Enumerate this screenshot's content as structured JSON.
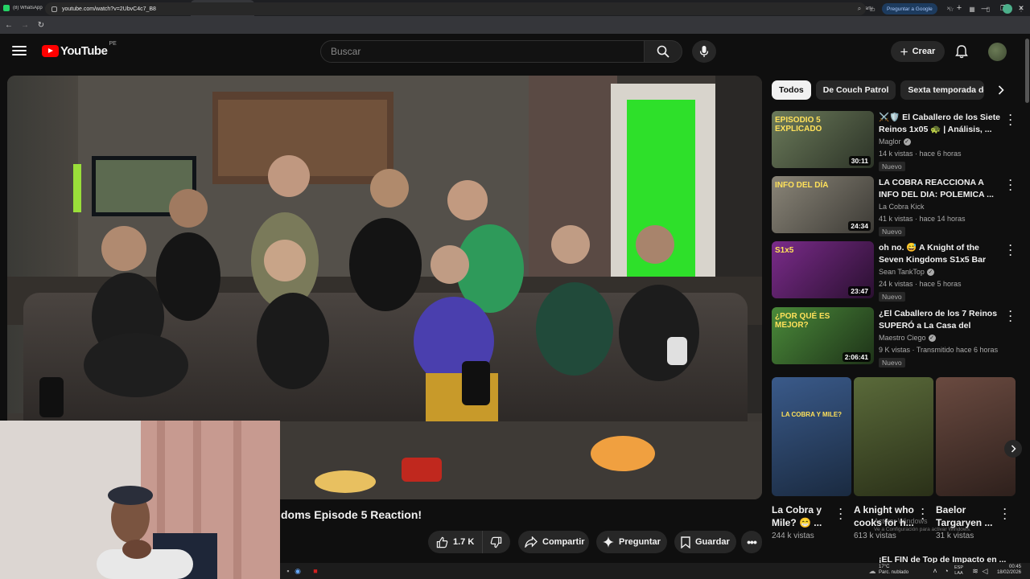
{
  "browser": {
    "tabs": [
      {
        "label": "(8) WhatsApp",
        "color": "#25d366",
        "active": false
      },
      {
        "label": "Lian_Sorth Stream",
        "color": "#53fc18",
        "active": false
      },
      {
        "label": "Stream - Kick Dash",
        "color": "#53fc18",
        "active": false
      },
      {
        "label": "ABSOLUTE",
        "color": "#ff0000",
        "active": true
      },
      {
        "label": "Inicio | Ver Anime",
        "color": "#c13584",
        "active": false
      },
      {
        "label": "Lv2 kara Cheat",
        "color": "#c13584",
        "active": false
      },
      {
        "label": "▷ Yuusha Go Shite",
        "color": "#c13584",
        "active": false
      },
      {
        "label": "▷ Super Cronos",
        "color": "#c13584",
        "active": false
      },
      {
        "label": "yuusha | Ver Anime",
        "color": "#c13584",
        "active": false
      },
      {
        "label": "▷ Yuusha Party",
        "color": "#c13584",
        "active": false
      },
      {
        "label": "▷ Burn the Witch",
        "color": "#c13584",
        "active": false
      },
      {
        "label": "▷ 86: Eighty-Six",
        "color": "#c13584",
        "active": false
      },
      {
        "label": "▷ Fate/strange Fake",
        "color": "#c13584",
        "active": false
      },
      {
        "label": "▷ Yuusha Party",
        "color": "#c13584",
        "active": false
      },
      {
        "label": "▷ Yuusha Kei",
        "color": "#c13584",
        "active": false
      }
    ],
    "url": "youtube.com/watch?v=2UbvC4c7_B8",
    "ask_google": "Preguntar a Google"
  },
  "header": {
    "logo_text": "YouTube",
    "country_code": "PE",
    "search_placeholder": "Buscar",
    "create_label": "Crear"
  },
  "video": {
    "title_visible": "doms Episode 5 Reaction!",
    "likes": "1.7 K",
    "share_label": "Compartir",
    "ask_label": "Preguntar",
    "save_label": "Guardar"
  },
  "sidebar": {
    "chips": [
      "Todos",
      "De Couch Patrol",
      "Sexta temporada de …"
    ],
    "recommendations": [
      {
        "title": "⚔️🛡️ El Caballero de los Siete Reinos 1x05 🐢 | Análisis, ...",
        "channel": "Maglor",
        "verified": true,
        "meta": "14 k vistas · hace 6 horas",
        "badge": "Nuevo",
        "duration": "30:11",
        "thumb_text": "EPISODIO 5 EXPLICADO",
        "c1": "#6b7a5a",
        "c2": "#2c3327"
      },
      {
        "title": "LA COBRA REACCIONA A INFO DEL DIA: POLEMICA ...",
        "channel": "La Cobra Kick",
        "verified": false,
        "meta": "41 k vistas · hace 14 horas",
        "badge": "Nuevo",
        "duration": "24:34",
        "thumb_text": "INFO DEL DÍA",
        "c1": "#8a8578",
        "c2": "#3c3a35"
      },
      {
        "title": "oh no. 😅 A Knight of the Seven Kingdoms S1x5 Bar Reaction!",
        "channel": "Sean TankTop",
        "verified": true,
        "meta": "24 k vistas · hace 5 horas",
        "badge": "Nuevo",
        "duration": "23:47",
        "thumb_text": "S1x5",
        "c1": "#7a2b8a",
        "c2": "#2a1030"
      },
      {
        "title": "¿El Caballero de los 7 Reinos SUPERÓ a La Casa del Dragón...",
        "channel": "Maestro Ciego",
        "verified": true,
        "meta": "9 K vistas · Transmitido hace 6 horas",
        "badge": "Nuevo",
        "duration": "2:06:41",
        "thumb_text": "¿POR QUÉ ES MEJOR?",
        "c1": "#4a8a3a",
        "c2": "#1e3218"
      }
    ],
    "shorts": [
      {
        "title": "La Cobra y Mile? 😁 ...",
        "views": "244 k vistas",
        "thumb_text": "LA COBRA Y MILE?",
        "c1": "#3a5a8a",
        "c2": "#1a2a40"
      },
      {
        "title": "A knight who cooks for h...",
        "views": "613 k vistas",
        "thumb_text": "",
        "c1": "#5a6a3a",
        "c2": "#2a3018"
      },
      {
        "title": "Baelor Targaryen ...",
        "views": "31 k vistas",
        "thumb_text": "",
        "c1": "#6a4a40",
        "c2": "#2e201c"
      }
    ],
    "next_title": "¡EL FIN de Top de Impacto en ..."
  },
  "system": {
    "activate_windows": "Activar Windows",
    "activate_sub": "Ve a Configuración para activar Windows.",
    "weather_temp": "17°C",
    "weather_desc": "Parc. nublado",
    "lang": "ESP",
    "lang_sub": "LAA",
    "time": "00:45",
    "date": "18/02/2026"
  },
  "colors": {
    "background": "#0f0f0f",
    "surface": "#272727",
    "brand_red": "#ff0000",
    "text": "#f1f1f1",
    "muted": "#aaaaaa"
  }
}
